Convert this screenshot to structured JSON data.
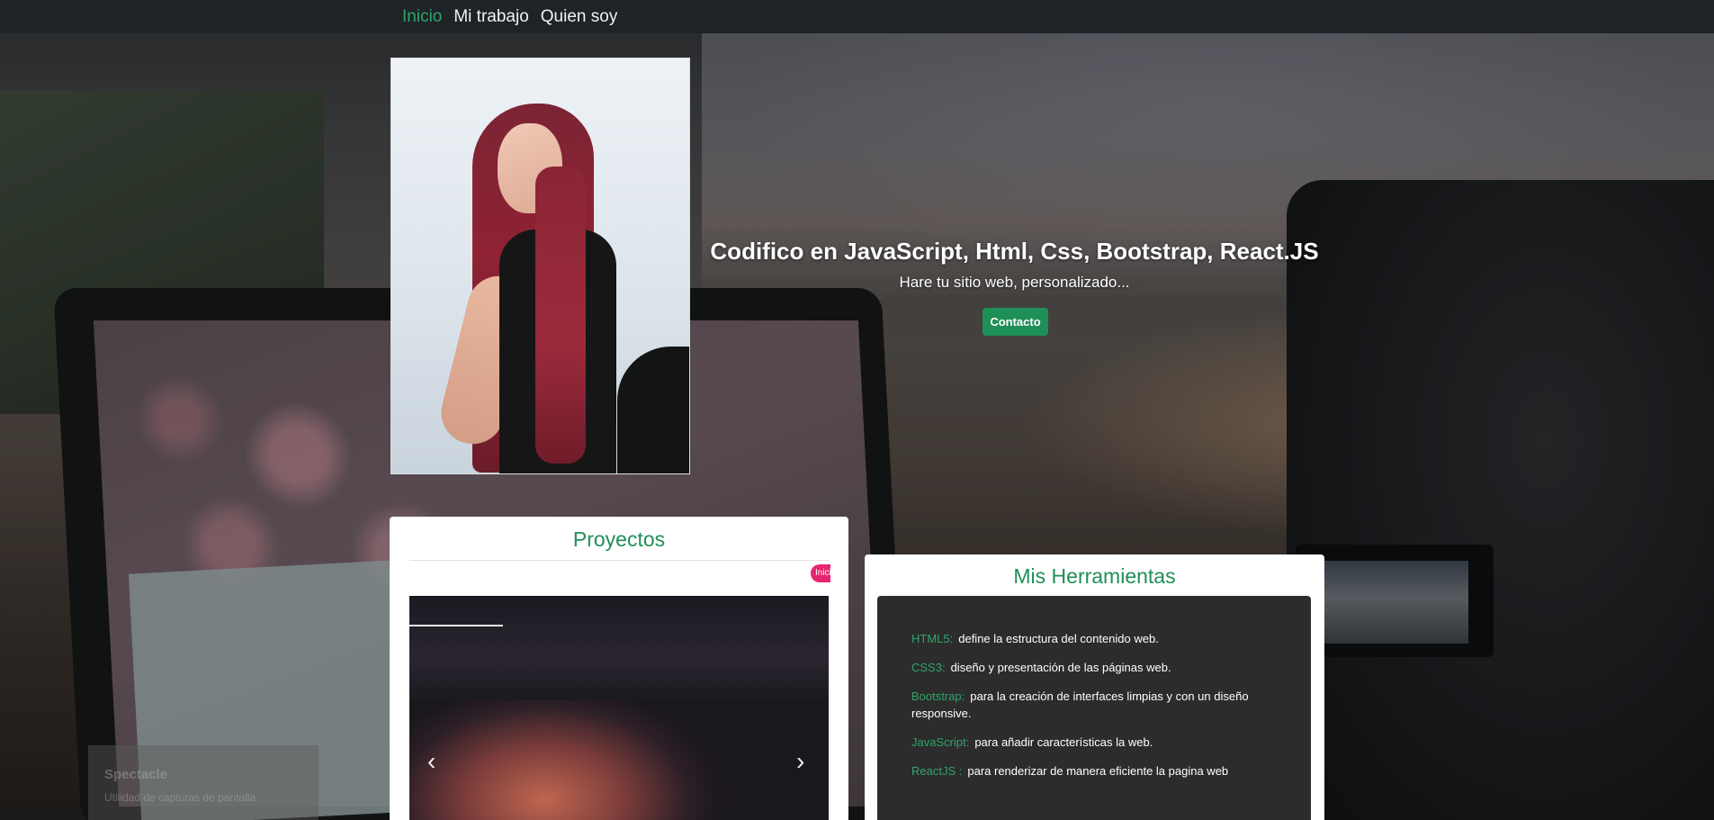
{
  "nav": {
    "items": [
      {
        "label": "Inicio",
        "active": true
      },
      {
        "label": "Mi trabajo",
        "active": false
      },
      {
        "label": "Quien soy",
        "active": false
      }
    ],
    "accent_color": "#2fa56c"
  },
  "hero": {
    "title": "Codifico en JavaScript, Html, Css, Bootstrap, React.JS",
    "subtitle": "Hare tu sitio web, personalizado...",
    "contact_button": "Contacto",
    "button_color": "#1f8f58"
  },
  "projects": {
    "title": "Proyectos",
    "badge": "Inici",
    "badge_color": "#e6246f",
    "carousel": {
      "prev_icon": "chevron-left-icon",
      "next_icon": "chevron-right-icon"
    }
  },
  "tools": {
    "title": "Mis Herramientas",
    "items": [
      {
        "name": "HTML5:",
        "desc": "define la estructura del contenido web."
      },
      {
        "name": "CSS3:",
        "desc": "diseño y presentación de las páginas web."
      },
      {
        "name": "Bootstrap:",
        "desc": "para la creación de interfaces limpias y con un diseño responsive."
      },
      {
        "name": "JavaScript:",
        "desc": "para añadir características la web."
      },
      {
        "name": "ReactJS :",
        "desc": "para renderizar de manera eficiente la pagina web"
      }
    ]
  },
  "overlay": {
    "app_name": "Spectacle",
    "app_desc": "Utilidad de capturas de pantalla"
  }
}
